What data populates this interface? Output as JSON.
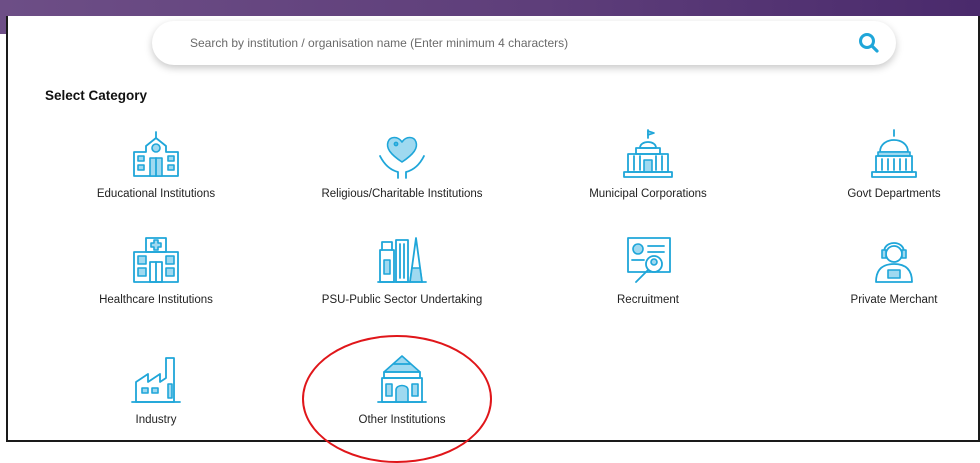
{
  "search": {
    "placeholder": "Search by institution / organisation name (Enter minimum 4 characters)"
  },
  "section_title": "Select Category",
  "categories": [
    {
      "label": "Educational Institutions",
      "icon": "school-building-icon"
    },
    {
      "label": "Religious/Charitable Institutions",
      "icon": "heart-hands-icon"
    },
    {
      "label": "Municipal Corporations",
      "icon": "municipal-building-icon"
    },
    {
      "label": "Govt Departments",
      "icon": "capitol-dome-icon"
    },
    {
      "label": "Healthcare Institutions",
      "icon": "hospital-icon"
    },
    {
      "label": "PSU-Public Sector Undertaking",
      "icon": "industrial-towers-icon"
    },
    {
      "label": "Recruitment",
      "icon": "resume-search-icon"
    },
    {
      "label": "Private Merchant",
      "icon": "merchant-person-icon"
    },
    {
      "label": "Industry",
      "icon": "factory-icon"
    },
    {
      "label": "Other Institutions",
      "icon": "temple-icon"
    }
  ],
  "colors": {
    "icon_accent": "#1fa6d9",
    "highlight_ring": "#e0161a",
    "header_band": "#5e3e7a"
  }
}
